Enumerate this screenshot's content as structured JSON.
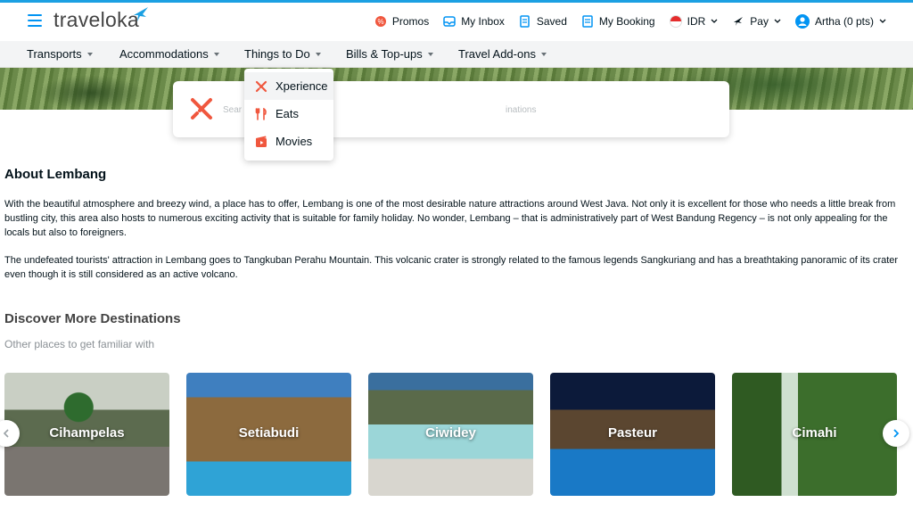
{
  "header": {
    "logo_text": "traveloka",
    "links": {
      "promos": "Promos",
      "inbox": "My Inbox",
      "saved": "Saved",
      "booking": "My Booking",
      "currency": "IDR",
      "pay": "Pay",
      "account": "Artha (0 pts)"
    }
  },
  "nav": {
    "transports": "Transports",
    "accommodations": "Accommodations",
    "things_to_do": "Things to Do",
    "bills": "Bills & Top-ups",
    "addons": "Travel Add-ons"
  },
  "dropdown": {
    "items": [
      {
        "label": "Xperience",
        "icon": "xperience-icon"
      },
      {
        "label": "Eats",
        "icon": "eats-icon"
      },
      {
        "label": "Movies",
        "icon": "movies-icon"
      }
    ]
  },
  "search": {
    "placeholder_left": "Sear",
    "placeholder_right": "inations"
  },
  "about": {
    "title": "About Lembang",
    "paragraph1": "With the beautiful atmosphere and breezy wind, a place has to offer, Lembang is one of the most desirable nature attractions around West Java. Not only it is excellent for those who needs a little break from bustling city, this area also hosts to numerous exciting activity that is suitable for family holiday. No wonder, Lembang – that is administratively part of West Bandung Regency – is not only appealing for the locals but also to foreigners.",
    "paragraph2": "The undefeated tourists' attraction in Lembang goes to Tangkuban Perahu Mountain. This volcanic crater is strongly related to the famous legends Sangkuriang and has a breathtaking panoramic of its crater even though it is still considered as an active volcano."
  },
  "discover": {
    "title": "Discover More Destinations",
    "subtitle": "Other places to get familiar with",
    "destinations": [
      "Cihampelas",
      "Setiabudi",
      "Ciwidey",
      "Pasteur",
      "Cimahi"
    ]
  },
  "colors": {
    "brand_blue": "#0194f3",
    "accent_red": "#f0573e",
    "text_dark": "#03121a"
  }
}
